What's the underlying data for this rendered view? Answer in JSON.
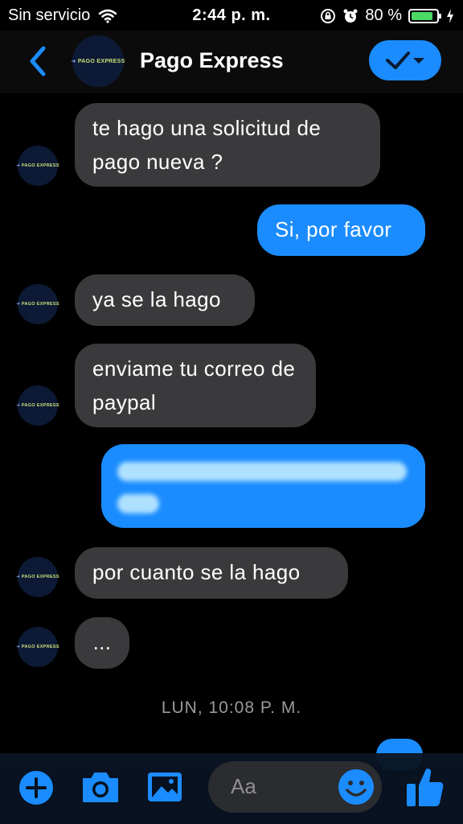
{
  "status": {
    "carrier": "Sin servicio",
    "time": "2:44 p. m.",
    "battery": "80 %",
    "battery_level": 0.8
  },
  "header": {
    "title": "Pago Express",
    "logo_text": "PAGO EXPRESS"
  },
  "messages": [
    {
      "side": "in",
      "text": "te hago una solicitud de pago nueva ?"
    },
    {
      "side": "out",
      "text": "Si, por favor"
    },
    {
      "side": "in",
      "text": "ya se la hago"
    },
    {
      "side": "in",
      "text": "enviame tu correo de paypal"
    },
    {
      "side": "out",
      "text": ""
    },
    {
      "side": "in",
      "text": "por cuanto se la hago"
    },
    {
      "side": "in",
      "text": "..."
    }
  ],
  "timestamp": "LUN, 10:08 P. M.",
  "composer": {
    "placeholder": "Aa"
  },
  "colors": {
    "accent": "#1b8cff",
    "incoming_bubble": "#3a3a3c",
    "background": "#000000",
    "battery": "#4cd964"
  }
}
